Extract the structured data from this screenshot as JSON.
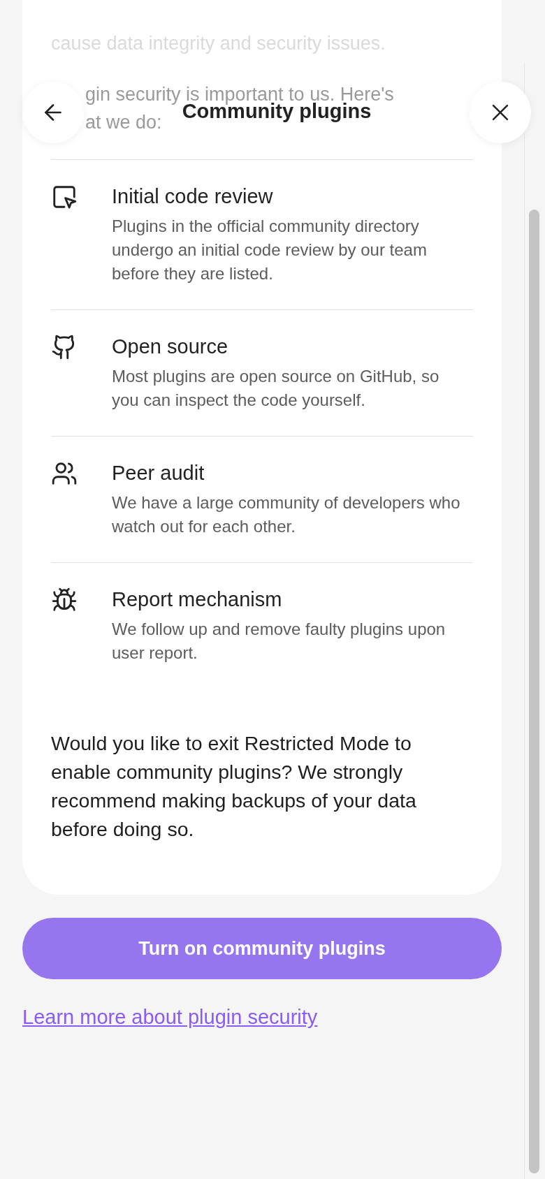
{
  "header": {
    "title": "Community plugins"
  },
  "intro_faded": [
    "cause data integrity and security issues.",
    "gin security is important to us. Here's",
    "at we do:"
  ],
  "features": [
    {
      "kind": "review",
      "title": "Initial code review",
      "description": "Plugins in the official community directory undergo an initial code review by our team before they are listed."
    },
    {
      "kind": "source",
      "title": "Open source",
      "description": "Most plugins are open source on GitHub, so you can inspect the code yourself."
    },
    {
      "kind": "peers",
      "title": "Peer audit",
      "description": "We have a large community of developers who watch out for each other."
    },
    {
      "kind": "bug",
      "title": "Report mechanism",
      "description": "We follow up and remove faulty plugins upon user report."
    }
  ],
  "question": "Would you like to exit Restricted Mode to enable community plugins? We strongly recommend making backups of your data before doing so.",
  "primary_button": "Turn on community plugins",
  "link": "Learn more about plugin security"
}
